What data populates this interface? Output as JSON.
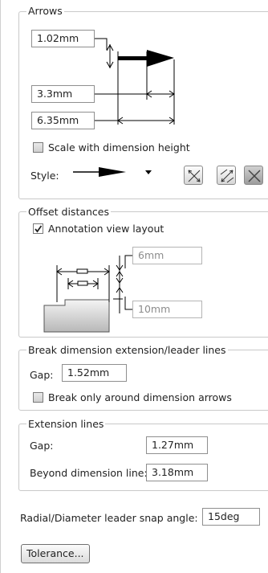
{
  "arrows": {
    "title": "Arrows",
    "arrow_height": "1.02mm",
    "arrow_width": "3.3mm",
    "arrow_length": "6.35mm",
    "scale_label": "Scale with dimension height",
    "scale_checked": false,
    "style_label": "Style:",
    "style_buttons": [
      "outside-arrows-icon",
      "inside-arrows-icon",
      "smart-arrows-icon"
    ]
  },
  "offset": {
    "title": "Offset distances",
    "annotation_label": "Annotation view layout",
    "annotation_checked": true,
    "offset_top": "6mm",
    "offset_bottom": "10mm"
  },
  "break": {
    "title": "Break dimension extension/leader lines",
    "gap_label": "Gap:",
    "gap_value": "1.52mm",
    "around_label": "Break only around dimension arrows",
    "around_checked": false
  },
  "extension": {
    "title": "Extension lines",
    "gap_label": "Gap:",
    "gap_value": "1.27mm",
    "beyond_label": "Beyond dimension line:",
    "beyond_value": "3.18mm"
  },
  "radial": {
    "label": "Radial/Diameter leader snap angle:",
    "value": "15deg"
  },
  "tolerance_button": "Tolerance..."
}
